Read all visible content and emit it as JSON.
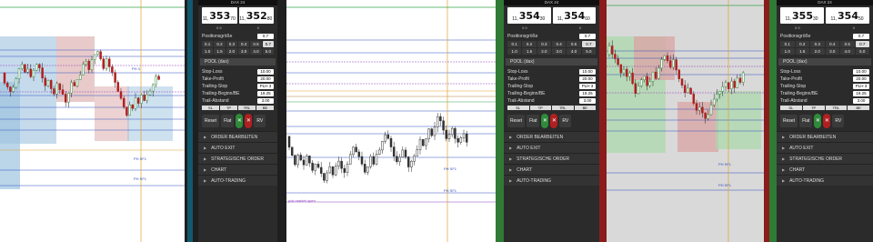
{
  "panels": [
    {
      "header": "DAX 24",
      "bid_small": "11,",
      "bid_big": "353",
      "bid_sup": "70",
      "ask_small": "11,",
      "ask_big": "352",
      "ask_sup": "80",
      "spread_left": "0.9",
      "spread_right": "0",
      "position_label": "Positionsgröße",
      "position_value": "0.7",
      "sizes": [
        "0.1",
        "0.2",
        "0.3",
        "0.4",
        "0.5",
        "0.7",
        "1.0",
        "1.5",
        "2.0",
        "3.0",
        "4.0",
        "5.0"
      ],
      "pool_label": "POOL (dax)",
      "stop_loss_label": "Stop-Loss",
      "stop_loss_value": "10.00",
      "take_profit_label": "Take-Profit",
      "take_profit_value": "20.00",
      "trailing_stop_label": "Trailing-Stop",
      "trailing_stop_value": "PLH 3",
      "trailing_begin_label": "Trailing-Beginn/BE",
      "trailing_begin_value": "19.25",
      "trail_abstand_label": "Trail-Abstand",
      "trail_abstand_value": "3.00",
      "mini_btns": [
        "SL",
        "TP",
        "TRL",
        "BE"
      ],
      "reset": "Reset",
      "flat": "Flat",
      "rv": "RV",
      "sections": [
        "ORDER BEARBEITEN",
        "AUTO EXIT",
        "STRATEGISCHE ORDER",
        "CHART",
        "AUTO-TRADING"
      ]
    },
    {
      "header": "DAX 24",
      "bid_small": "11,",
      "bid_big": "354",
      "bid_sup": "30",
      "ask_small": "11,",
      "ask_big": "354",
      "ask_sup": "60",
      "spread_left": "0.9",
      "spread_right": "0",
      "position_label": "Positionsgröße",
      "position_value": "0.7",
      "sizes": [
        "0.1",
        "0.2",
        "0.3",
        "0.4",
        "0.5",
        "0.7",
        "1.0",
        "1.5",
        "2.0",
        "3.0",
        "4.0",
        "5.0"
      ],
      "pool_label": "POOL (dax)",
      "stop_loss_label": "Stop-Loss",
      "stop_loss_value": "10.00",
      "take_profit_label": "Take-Profit",
      "take_profit_value": "20.00",
      "trailing_stop_label": "Trailing-Stop",
      "trailing_stop_value": "PLH 3",
      "trailing_begin_label": "Trailing-Beginn/BE",
      "trailing_begin_value": "19.25",
      "trail_abstand_label": "Trail-Abstand",
      "trail_abstand_value": "3.00",
      "mini_btns": [
        "SL",
        "TP",
        "TRL",
        "BE"
      ],
      "reset": "Reset",
      "flat": "Flat",
      "rv": "RV",
      "sections": [
        "ORDER BEARBEITEN",
        "AUTO EXIT",
        "STRATEGISCHE ORDER",
        "CHART",
        "AUTO-TRADING"
      ]
    },
    {
      "header": "DAX 24",
      "bid_small": "11,",
      "bid_big": "355",
      "bid_sup": "30",
      "ask_small": "11,",
      "ask_big": "354",
      "ask_sup": "50",
      "spread_left": "0.9",
      "spread_right": "0",
      "position_label": "Positionsgröße",
      "position_value": "0.7",
      "sizes": [
        "0.1",
        "0.2",
        "0.3",
        "0.4",
        "0.5",
        "0.7",
        "1.0",
        "1.5",
        "2.0",
        "3.0",
        "4.0",
        "5.0"
      ],
      "pool_label": "POOL (dax)",
      "stop_loss_label": "Stop-Loss",
      "stop_loss_value": "10.00",
      "take_profit_label": "Take-Profit",
      "take_profit_value": "20.00",
      "trailing_stop_label": "Trailing-Stop",
      "trailing_stop_value": "PLH 3",
      "trailing_begin_label": "Trailing-Beginn/BE",
      "trailing_begin_value": "19.25",
      "trail_abstand_label": "Trail-Abstand",
      "trail_abstand_value": "3.00",
      "mini_btns": [
        "SL",
        "TP",
        "TRL",
        "BE"
      ],
      "reset": "Reset",
      "flat": "Flat",
      "rv": "RV",
      "sections": [
        "ORDER BEARBEITEN",
        "AUTO EXIT",
        "STRATEGISCHE ORDER",
        "CHART",
        "AUTO-TRADING"
      ]
    }
  ],
  "chart_labels": {
    "ph": "PH 3",
    "ph_s1": "PH SF1",
    "market_open": "pok market open"
  },
  "colors": {
    "up": "#2e8b3d",
    "down": "#222222",
    "zone_blue": "#9ec3df",
    "zone_red": "#d9a6a6",
    "zone_green": "#a9d8a9",
    "line_blue": "#3050c0",
    "line_orange": "#e0a030",
    "line_purple": "#9040c0"
  }
}
